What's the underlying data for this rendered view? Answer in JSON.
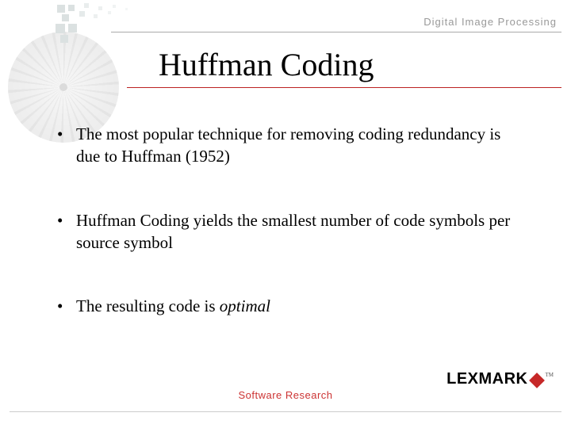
{
  "header": {
    "label": "Digital Image Processing"
  },
  "title": "Huffman Coding",
  "bullets": [
    {
      "html": "The most popular technique for removing coding redundancy is due to Huffman (1952)"
    },
    {
      "html": "Huffman Coding yields the smallest number of code symbols per source symbol"
    },
    {
      "html": "The resulting code is <em>optimal</em>"
    }
  ],
  "footer": {
    "label": "Software Research"
  },
  "logo": {
    "text": "LEXMARK",
    "tm": "TM"
  }
}
